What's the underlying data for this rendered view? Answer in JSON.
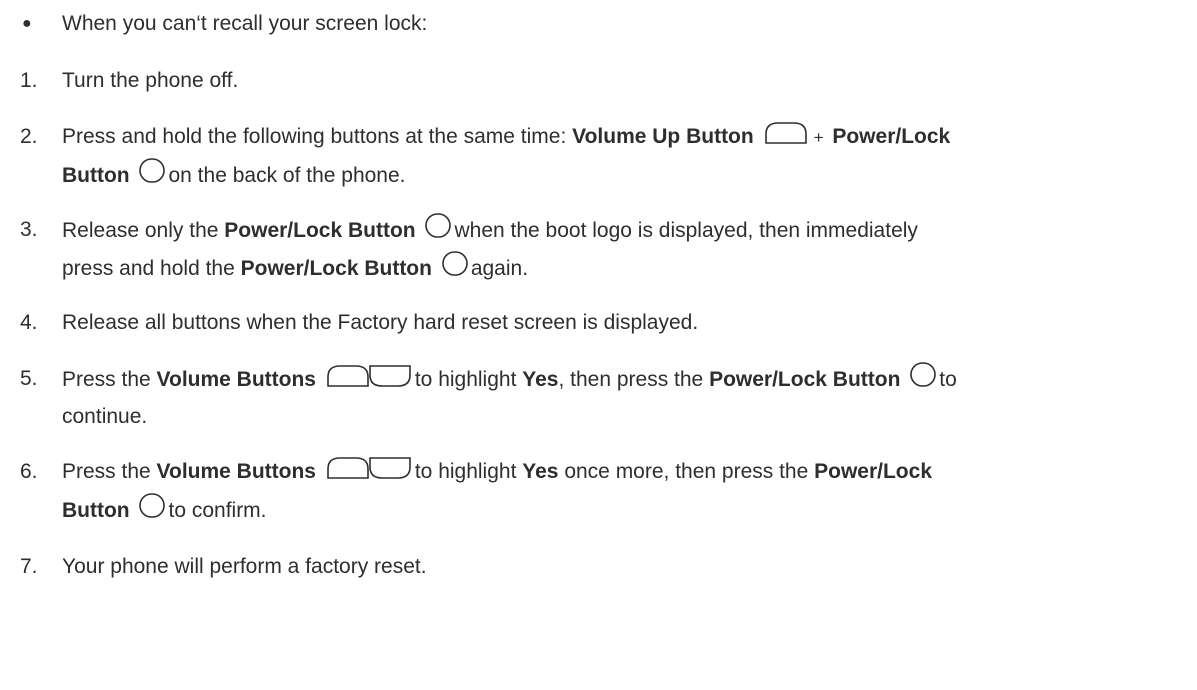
{
  "intro": {
    "text": "When you can‘t recall your screen lock:"
  },
  "steps": [
    {
      "number": "1.",
      "parts": [
        "Turn the phone off."
      ]
    },
    {
      "number": "2.",
      "parts": [
        "Press and hold the following buttons at the same time: ",
        "Volume Up Button",
        "+",
        "Power/Lock",
        "Button",
        "on the back of the phone."
      ]
    },
    {
      "number": "3.",
      "parts": [
        "Release only the ",
        "Power/Lock Button",
        "when the boot logo is displayed, then immediately",
        "press and hold the ",
        "Power/Lock Button",
        "again."
      ]
    },
    {
      "number": "4.",
      "parts": [
        "Release all buttons when the Factory hard reset screen is displayed."
      ]
    },
    {
      "number": "5.",
      "parts": [
        "Press the ",
        "Volume Buttons",
        "to highlight ",
        "Yes",
        ", then press the ",
        "Power/Lock Button",
        "to",
        "continue."
      ]
    },
    {
      "number": "6.",
      "parts": [
        "Press the ",
        "Volume Buttons",
        "to highlight ",
        "Yes",
        " once more, then press the ",
        "Power/Lock",
        "Button",
        "to confirm."
      ]
    },
    {
      "number": "7.",
      "parts": [
        "Your phone will perform a factory reset."
      ]
    }
  ],
  "icons": {
    "volume_up": "volume-up-button-icon",
    "volume_down": "volume-down-button-icon",
    "power": "power-lock-button-icon"
  },
  "colors": {
    "text": "#2e2e2e",
    "background": "#ffffff"
  }
}
